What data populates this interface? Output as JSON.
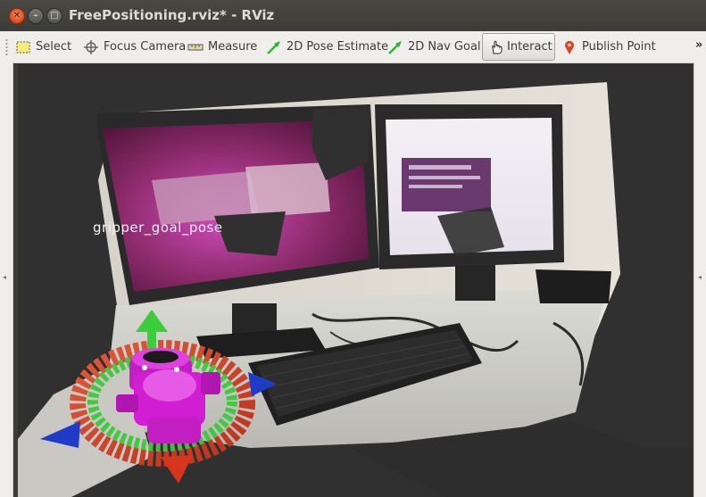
{
  "window": {
    "title": "FreePositioning.rviz* - RViz",
    "close_symbol": "✕",
    "min_symbol": "–",
    "max_symbol": "□"
  },
  "toolbar": {
    "tools": [
      {
        "id": "select",
        "label": "Select",
        "icon": "select-icon"
      },
      {
        "id": "focus-camera",
        "label": "Focus Camera",
        "icon": "crosshair-icon"
      },
      {
        "id": "measure",
        "label": "Measure",
        "icon": "ruler-icon"
      },
      {
        "id": "2d-pose-estimate",
        "label": "2D Pose Estimate",
        "icon": "green-arrow-icon"
      },
      {
        "id": "2d-nav-goal",
        "label": "2D Nav Goal",
        "icon": "green-arrow-icon"
      },
      {
        "id": "interact",
        "label": "Interact",
        "icon": "hand-cursor-icon",
        "active": true
      },
      {
        "id": "publish-point",
        "label": "Publish Point",
        "icon": "map-pin-icon"
      }
    ],
    "overflow": "»"
  },
  "panels": {
    "left_arrow": "◂",
    "right_arrow": "◂"
  },
  "viewport": {
    "marker_text": "gripper_goal_pose",
    "colors": {
      "background": "#303030",
      "marker_body": "#d21ed2",
      "ring_red": "#d33c2a",
      "ring_green": "#3cc83c",
      "arrow_blue": "#1e3cc8",
      "arrow_green": "#32c832"
    }
  }
}
